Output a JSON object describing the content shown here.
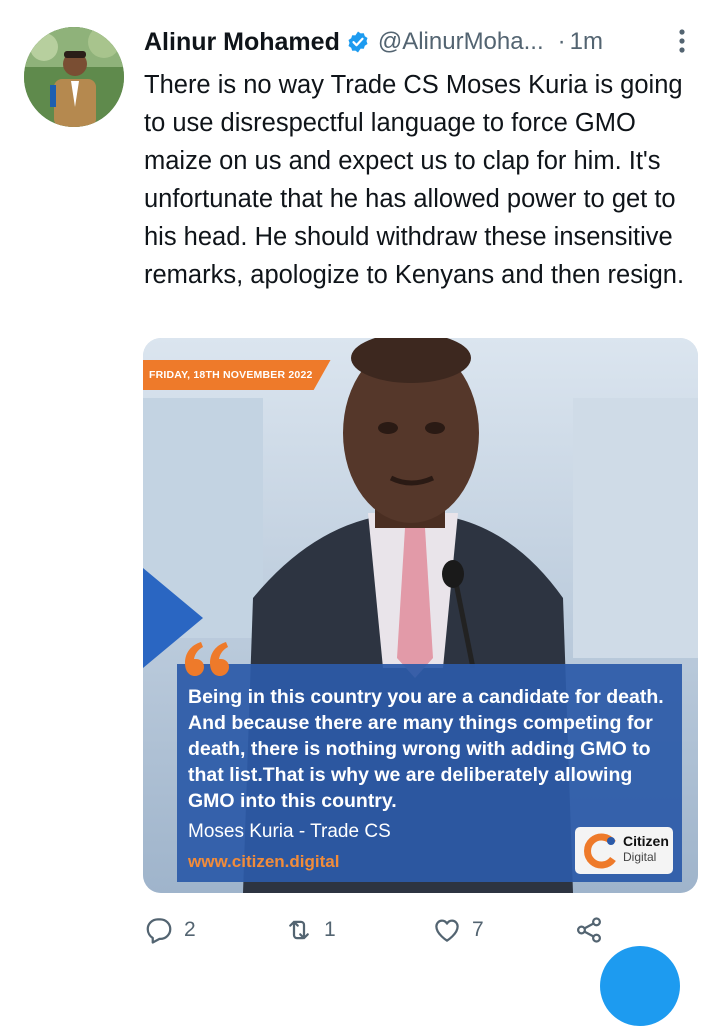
{
  "tweet": {
    "author_name": "Alinur Mohamed",
    "handle": "@AlinurMoha...",
    "separator": "·",
    "time": "1m",
    "text": "There is no way Trade CS Moses Kuria is going to use disrespectful language to force GMO maize on us and expect us to clap for him. It's unfortunate that he has allowed power to get to his head. He should withdraw these insensitive remarks, apologize to Kenyans and then resign."
  },
  "media": {
    "date_tag": "FRIDAY, 18TH NOVEMBER 2022",
    "quote": "Being in this country you are a candidate for death. And because there are many things competing for death, there is nothing wrong with adding GMO to that list.That is why we are deliberately allowing GMO into this country.",
    "author": "Moses Kuria - Trade CS",
    "url": "www.citizen.digital",
    "logo_line1": "Citizen",
    "logo_line2": "Digital"
  },
  "actions": {
    "reply_count": "2",
    "retweet_count": "1",
    "like_count": "7"
  },
  "icons": {
    "verified": "verified-badge-icon",
    "more": "more-options-icon",
    "reply": "reply-icon",
    "retweet": "retweet-icon",
    "like": "like-icon",
    "share": "share-icon"
  },
  "colors": {
    "accent": "#1d9bf0",
    "muted_text": "#536471",
    "quote_panel": "#2c5aa8",
    "date_tag": "#ee7a2a"
  }
}
